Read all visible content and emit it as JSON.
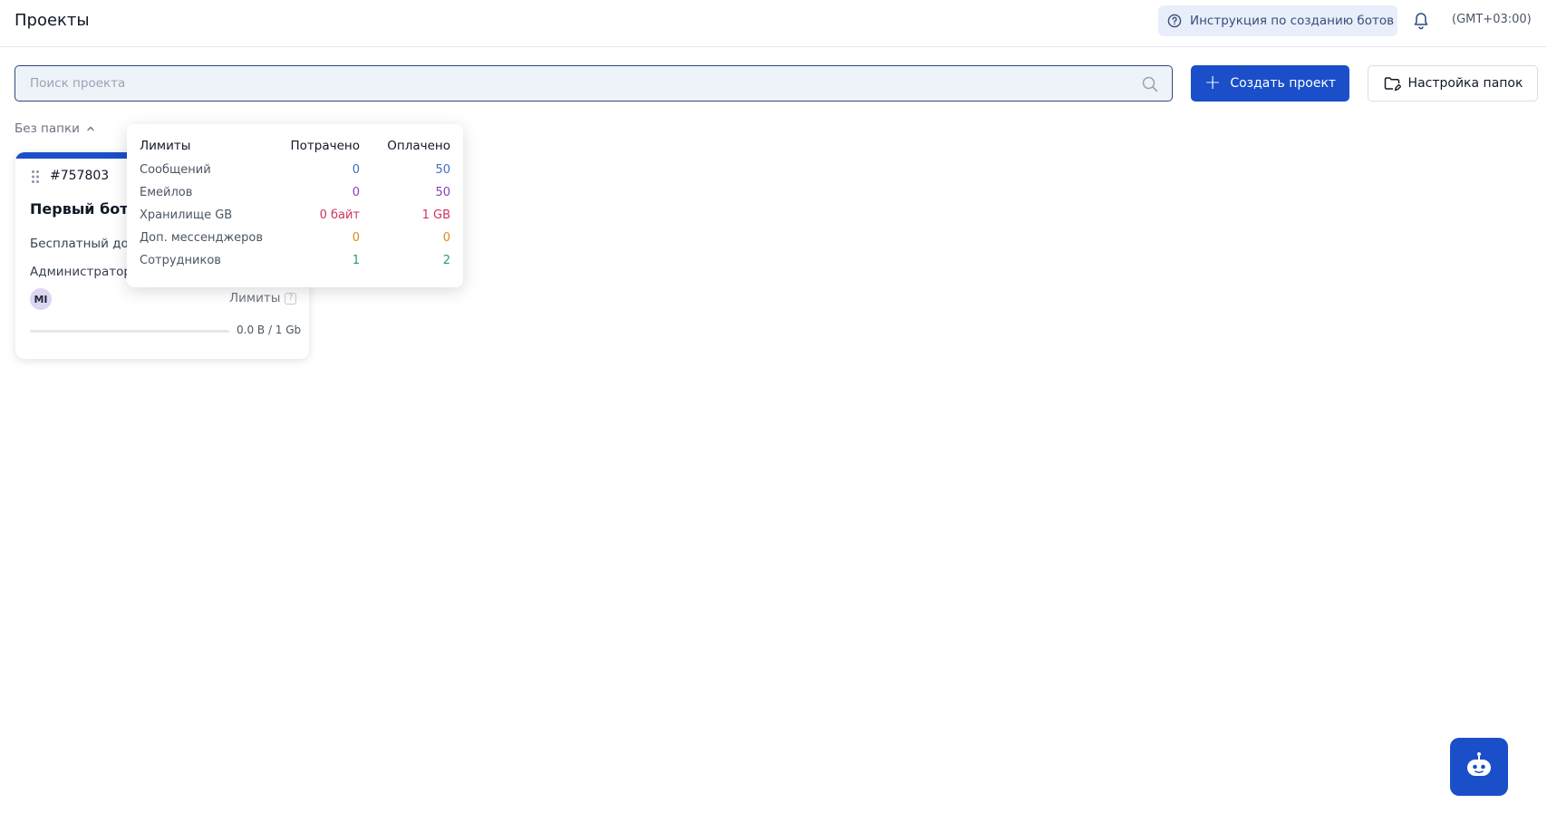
{
  "header": {
    "title": "Проекты",
    "help_label": "Инструкция по созданию ботов",
    "timezone": "(GMT+03:00)"
  },
  "search": {
    "placeholder": "Поиск проекта",
    "value": ""
  },
  "actions": {
    "create_label": "Создать проект",
    "folders_label": "Настройка папок"
  },
  "folder": {
    "label": "Без папки"
  },
  "project_card": {
    "id": "#757803",
    "name": "Первый бот",
    "plan": "Бесплатный до 1",
    "role": "Администратор",
    "avatar_initials": "MI",
    "limits_label": "Лимиты",
    "storage_text": "0.0 B / 1 Gb",
    "storage_fraction": 0,
    "accent_color": "#1a4fc9"
  },
  "limits_popup": {
    "col_limits": "Лимиты",
    "col_spent": "Потрачено",
    "col_paid": "Оплачено",
    "rows": [
      {
        "label": "Сообщений",
        "spent": "0",
        "paid": "50",
        "color": "#3b6fc4"
      },
      {
        "label": "Емейлов",
        "spent": "0",
        "paid": "50",
        "color": "#8b3fb8"
      },
      {
        "label": "Хранилище GB",
        "spent": "0 байт",
        "paid": "1 GB",
        "color": "#d0335a"
      },
      {
        "label": "Доп. мессенджеров",
        "spent": "0",
        "paid": "0",
        "color": "#e08a1a"
      },
      {
        "label": "Сотрудников",
        "spent": "1",
        "paid": "2",
        "color": "#1fa46a"
      }
    ]
  },
  "icons": {
    "help": "question-circle-icon",
    "bell": "bell-icon",
    "search": "search-icon",
    "plus": "plus-icon",
    "folder_settings": "folder-settings-icon",
    "chevron": "chevron-up-icon",
    "drag": "drag-handle-icon",
    "chat": "chat-bot-icon"
  }
}
